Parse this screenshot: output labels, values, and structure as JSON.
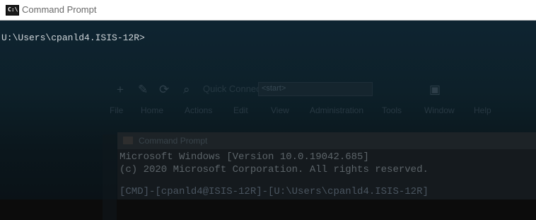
{
  "window": {
    "title": "Command Prompt",
    "icon": "console-icon",
    "icon_text": "C:\\."
  },
  "console": {
    "prompt": "U:\\Users\\cpanld4.ISIS-12R>"
  },
  "background_app": {
    "quick_connect_label": "Quick Connect",
    "quick_connect_value": "<start>",
    "menu": [
      "File",
      "Home",
      "Actions",
      "Edit",
      "View",
      "Administration",
      "Tools",
      "Window",
      "Help"
    ],
    "inner_terminal": {
      "title": "Command Prompt",
      "line1": "Microsoft Windows [Version 10.0.19042.685]",
      "line2": "(c) 2020 Microsoft Corporation. All rights reserved.",
      "line3": "[CMD]-[cpanld4@ISIS-12R]-[U:\\Users\\cpanld4.ISIS-12R]"
    }
  }
}
